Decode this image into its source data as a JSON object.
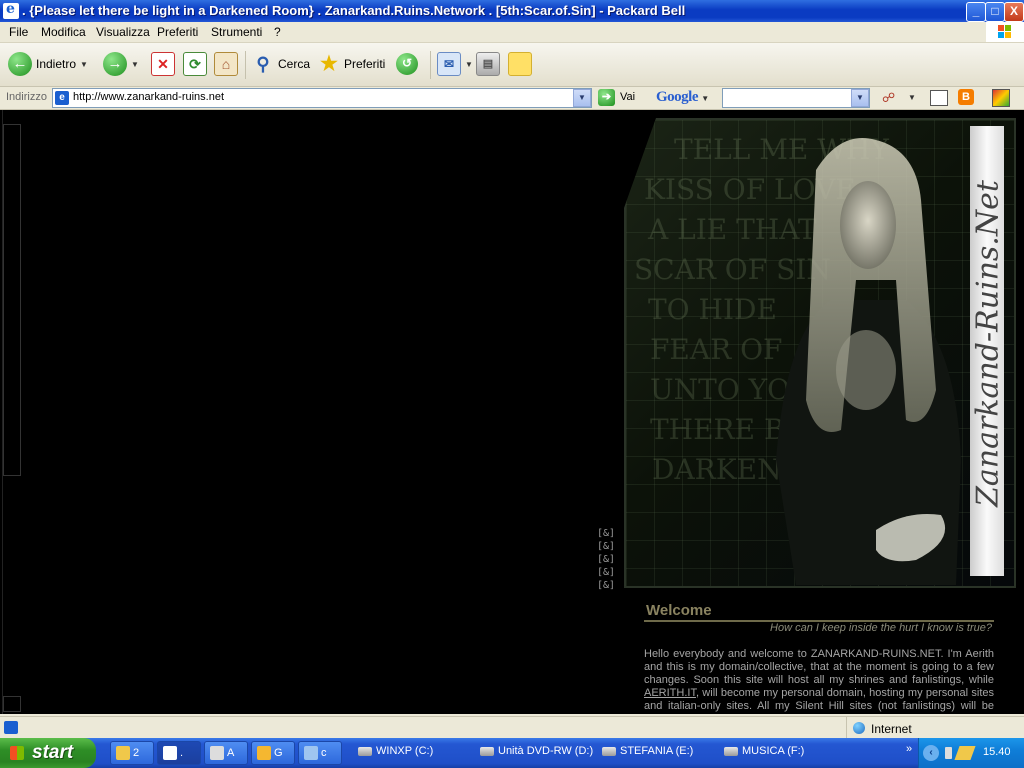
{
  "window": {
    "title": ". {Please let there be light in a Darkened Room} . Zanarkand.Ruins.Network . [5th:Scar.of.Sin]  - Packard Bell",
    "minimize": "_",
    "maximize": "□",
    "close": "X"
  },
  "menu": [
    "File",
    "Modifica",
    "Visualizza",
    "Preferiti",
    "Strumenti",
    "?"
  ],
  "toolbar": {
    "back_label": "Indietro",
    "search_label": "Cerca",
    "favorites_label": "Preferiti"
  },
  "address": {
    "label": "Indirizzo",
    "url": "http://www.zanarkand-ruins.net",
    "go_label": "Vai",
    "google_label": "Google"
  },
  "page": {
    "amp_links": [
      "[&]",
      "[&]",
      "[&]",
      "[&]",
      "[&]"
    ],
    "lyrics": [
      "TELL ME WHY",
      "KISS OF LOVE",
      "A LIE THAT",
      "SCAR OF SIN",
      "TO HIDE",
      "FEAR OF",
      "UNTO YOU",
      "THERE BE LIGHT",
      "DARKENED ROOM"
    ],
    "logo_text": "Zanarkand-Ruins.Net",
    "welcome_title": "Welcome",
    "tagline": "How can I keep inside the hurt I know is true?",
    "body_1": "Hello everybody and welcome to ZANARKAND-RUINS.NET. I'm Aerith and this is my domain/collective, that at the moment is going to a few changes. Soon this site will host all my shrines and fanlistings, while ",
    "body_link": "AERITH.IT",
    "body_2": ", will become my personal domain, hosting my personal sites and italian-only sites. All my Silent Hill sites (not fanlistings) will be moved to"
  },
  "status": {
    "zone": "Internet"
  },
  "taskbar": {
    "start": "start",
    "tasks": [
      "2",
      ".",
      "A",
      "G",
      "c"
    ],
    "drives": [
      "WINXP (C:)",
      "Unità DVD-RW (D:)",
      "STEFANIA (E:)",
      "MUSICA (F:)"
    ],
    "overflow": "»",
    "clock": "15.40"
  }
}
